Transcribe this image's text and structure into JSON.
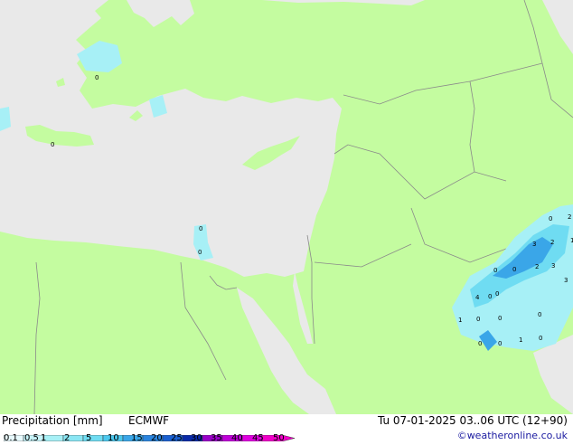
{
  "map": {
    "colors": {
      "land": "#c4fca0",
      "sea": "#e9e9e9",
      "border": "#8a8a8a",
      "precip_light": "#a7f0f6",
      "precip_mid": "#6fdcf2",
      "precip_heavy": "#3aa6e8"
    },
    "labels": [
      {
        "text": "0"
      },
      {
        "text": "0"
      },
      {
        "text": "0"
      },
      {
        "text": "0"
      },
      {
        "text": "0"
      },
      {
        "text": "2"
      },
      {
        "text": "3"
      },
      {
        "text": "1"
      },
      {
        "text": "0"
      },
      {
        "text": "0"
      },
      {
        "text": "2"
      },
      {
        "text": "3"
      },
      {
        "text": "3"
      },
      {
        "text": "2"
      },
      {
        "text": "4"
      },
      {
        "text": "0"
      },
      {
        "text": "0"
      },
      {
        "text": "1"
      },
      {
        "text": "0"
      },
      {
        "text": "0"
      },
      {
        "text": "0"
      },
      {
        "text": "0"
      },
      {
        "text": "1"
      },
      {
        "text": "0"
      },
      {
        "text": "0"
      }
    ]
  },
  "footer": {
    "title": "Precipitation [mm]",
    "model": "ECMWF",
    "datetime": "Tu 07-01-2025 03..06 UTC (12+90)",
    "credit": "©weatheronline.co.uk"
  },
  "scale": {
    "ticks": [
      "0.1",
      "0.5",
      "1",
      "2",
      "5",
      "10",
      "15",
      "20",
      "25",
      "30",
      "35",
      "40",
      "45",
      "50"
    ],
    "colors": [
      "#e8fafe",
      "#c8f4fa",
      "#a7f0f6",
      "#8ae6f4",
      "#6fdcf2",
      "#4cc8ee",
      "#3aa6e8",
      "#2a84de",
      "#1a60d0",
      "#0a2aa8",
      "#9a00c8",
      "#c000d8",
      "#e000e0",
      "#f000c8"
    ]
  }
}
